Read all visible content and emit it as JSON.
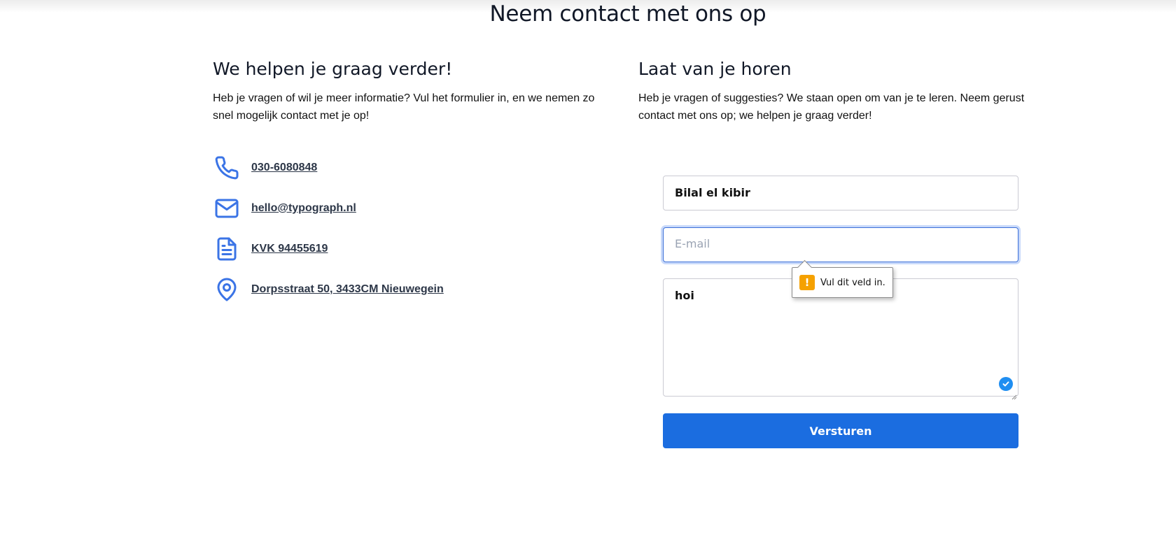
{
  "page": {
    "title": "Neem contact met ons op"
  },
  "left": {
    "heading": "We helpen je graag verder!",
    "intro": "Heb je vragen of wil je meer informatie? Vul het formulier in, en we nemen zo snel mogelijk contact met je op!",
    "contacts": [
      {
        "icon": "phone-icon",
        "text": "030-6080848"
      },
      {
        "icon": "mail-icon",
        "text": "hello@typograph.nl"
      },
      {
        "icon": "document-icon",
        "text": "KVK 94455619"
      },
      {
        "icon": "location-pin-icon",
        "text": "Dorpsstraat 50, 3433CM Nieuwegein"
      }
    ]
  },
  "right": {
    "heading": "Laat van je horen",
    "intro": "Heb je vragen of suggesties? We staan open om van je te leren. Neem gerust contact met ons op; we helpen je graag verder!"
  },
  "form": {
    "name_value": "Bilal el kibir",
    "email_value": "",
    "email_placeholder": "E-mail",
    "message_value": "hoi",
    "submit_label": "Versturen",
    "validation_message": "Vul dit veld in."
  },
  "colors": {
    "accent": "#1b6de0",
    "icon": "#3b74e6",
    "warning": "#f5a100"
  }
}
